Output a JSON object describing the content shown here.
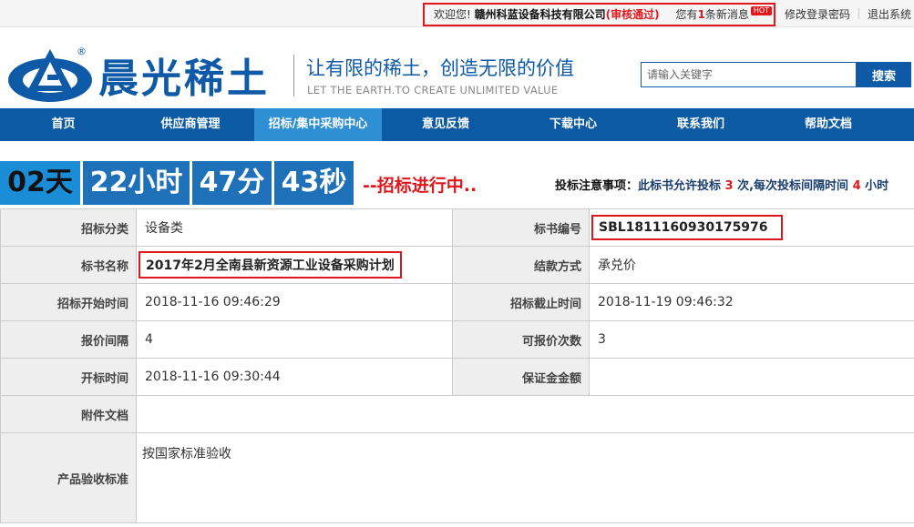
{
  "topbar": {
    "welcome": "欢迎您!",
    "company": "赣州科蓝设备科技有限公司",
    "status": "(审核通过)",
    "msg_prefix": "您有",
    "msg_count": "1",
    "msg_suffix": "条新消息",
    "hot": "HOT",
    "change_password": "修改登录密码",
    "logout": "退出系统"
  },
  "header": {
    "brand": "晨光稀土",
    "reg_mark": "®",
    "slogan": "让有限的稀土，创造无限的价值",
    "slogan_en": "LET THE EARTH.TO CREATE UNLIMITED VALUE",
    "search_placeholder": "请输入关键字",
    "search_button": "搜索"
  },
  "nav": {
    "items": [
      "首页",
      "供应商管理",
      "招标/集中采购中心",
      "意见反馈",
      "下载中心",
      "联系我们",
      "帮助文档"
    ],
    "active_index": 2
  },
  "countdown": {
    "days": "02天",
    "hours": "22小时",
    "minutes": "47分",
    "seconds": "43秒",
    "status": "--招标进行中.."
  },
  "notice": {
    "label": "投标注意事项：",
    "part1": "此标书允许投标 ",
    "allow": "3",
    "part2": " 次,每次投标间隔时间 ",
    "interval": "4",
    "part3": " 小时"
  },
  "details": {
    "category_label": "招标分类",
    "category": "设备类",
    "code_label": "标书编号",
    "code": "SBL1811160930175976",
    "name_label": "标书名称",
    "name": "2017年2月全南县新资源工业设备采购计划",
    "payment_label": "结款方式",
    "payment": "承兑价",
    "start_label": "招标开始时间",
    "start": "2018-11-16 09:46:29",
    "end_label": "招标截止时间",
    "end": "2018-11-19 09:46:32",
    "quote_interval_label": "报价间隔",
    "quote_interval": "4",
    "quote_times_label": "可报价次数",
    "quote_times": "3",
    "open_time_label": "开标时间",
    "open_time": "2018-11-16 09:30:44",
    "deposit_label": "保证金金额",
    "deposit": "",
    "attachment_label": "附件文档",
    "attachment": "",
    "acceptance_label": "产品验收标准",
    "acceptance": "按国家标准验收"
  },
  "colors": {
    "brand_blue": "#0e5aa7",
    "nav_blue": "#0b5aa3",
    "nav_active": "#2f8fd4",
    "highlight_red": "#e0181e"
  }
}
